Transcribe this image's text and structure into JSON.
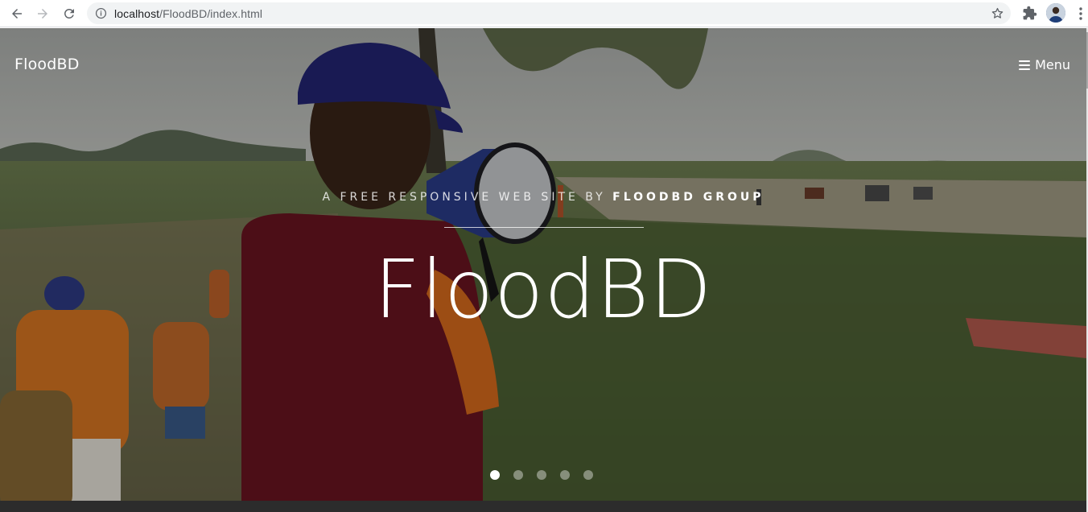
{
  "browser": {
    "url_host": "localhost",
    "url_path": "/FloodBD/index.html",
    "icons": {
      "back": "arrow-left-icon",
      "forward": "arrow-right-icon",
      "reload": "reload-icon",
      "info": "info-icon",
      "bookmark": "star-icon",
      "extensions": "puzzle-icon",
      "profile": "avatar",
      "menu": "kebab-icon"
    }
  },
  "navbar": {
    "brand": "FloodBD",
    "menu_label": "Menu",
    "menu_icon": "hamburger-icon"
  },
  "hero": {
    "tagline_prefix": "A FREE RESPONSIVE WEB SITE BY ",
    "tagline_strong": "FLOODBD GROUP",
    "title": "FloodBD",
    "slides": {
      "count": 5,
      "active_index": 0
    }
  },
  "colors": {
    "accent_white": "#ffffff",
    "omnibox_bg": "#f1f3f4"
  }
}
